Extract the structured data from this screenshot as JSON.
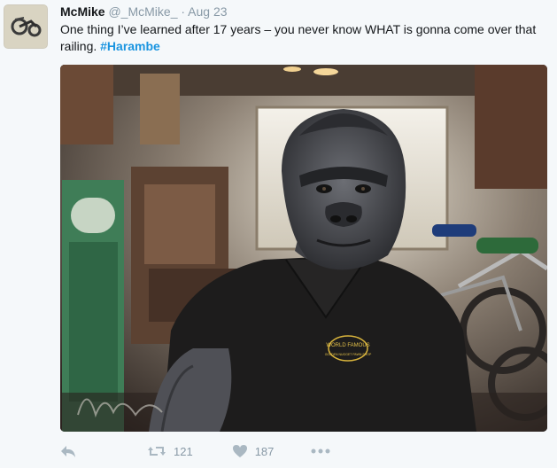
{
  "user": {
    "name": "McMike",
    "handle": "@_McMike_",
    "separator": "·",
    "date": "Aug 23"
  },
  "tweet": {
    "text": "One thing I’ve learned after 17 years – you never know WHAT is gonna come over that railing. ",
    "hashtag": "#Harambe"
  },
  "media": {
    "description_icon": "photo",
    "shirt_logo_text_1": "WORLD FAMOUS",
    "shirt_logo_text_2": "GOLDEN NUGGET PAWN SHOP"
  },
  "actions": {
    "reply_icon": "reply-icon",
    "retweet_icon": "retweet-icon",
    "retweet_count": "121",
    "like_icon": "heart-icon",
    "like_count": "187",
    "more_icon": "more-icon"
  },
  "colors": {
    "hashtag": "#1b95e0",
    "muted": "#8899a6",
    "icon": "#aab8c2",
    "background": "#f5f8fa"
  }
}
